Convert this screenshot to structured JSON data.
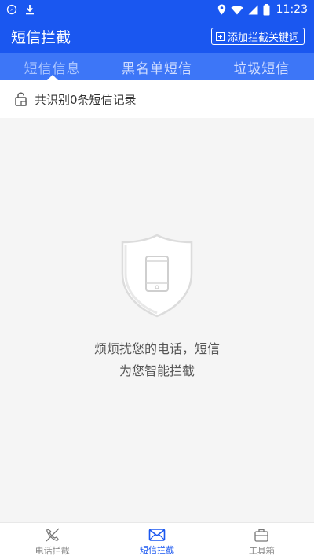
{
  "status_bar": {
    "time": "11:23"
  },
  "app_bar": {
    "title": "短信拦截",
    "add_keyword_label": "添加拦截关键词"
  },
  "tabs": [
    {
      "label": "短信信息"
    },
    {
      "label": "黑名单短信"
    },
    {
      "label": "垃圾短信"
    }
  ],
  "record_count": {
    "text": "共识别0条短信记录"
  },
  "empty_state": {
    "line1": "烦烦扰您的电话，短信",
    "line2": "为您智能拦截"
  },
  "bottom_nav": [
    {
      "label": "电话拦截",
      "icon": "phone-blocked-icon"
    },
    {
      "label": "短信拦截",
      "icon": "envelope-icon"
    },
    {
      "label": "工具箱",
      "icon": "toolbox-icon"
    }
  ],
  "colors": {
    "primary": "#1a57f0",
    "tab_bg": "#3d76f7"
  }
}
